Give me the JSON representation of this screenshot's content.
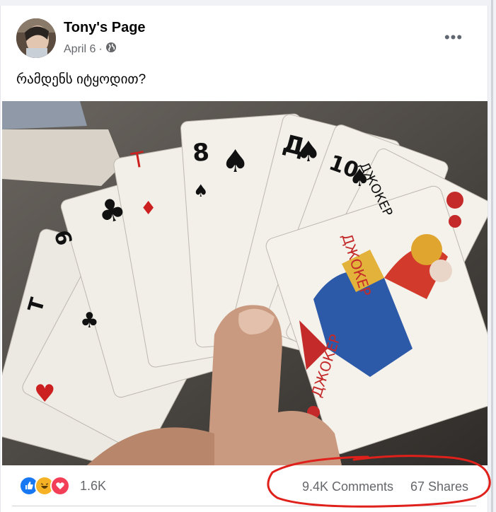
{
  "post": {
    "page_name": "Tony's Page",
    "date": "April 6",
    "separator": "·",
    "privacy_icon": "globe-icon",
    "more_icon": "more-options-icon",
    "more_label": "•••",
    "caption": "რამდენს იტყოდით?"
  },
  "photo": {
    "card_texts": [
      "Д",
      "10",
      "8",
      "9",
      "Т",
      "ДЖОКЕР",
      "ДЖОКЕР"
    ]
  },
  "footer": {
    "reaction_icons": [
      "like-icon",
      "haha-icon",
      "love-icon"
    ],
    "reaction_count": "1.6K",
    "comments": "9.4K Comments",
    "shares": "67 Shares"
  },
  "colors": {
    "like": "#1877f2",
    "love": "#f33e58",
    "haha": "#f7b125",
    "annotation_red": "#e0201b"
  }
}
